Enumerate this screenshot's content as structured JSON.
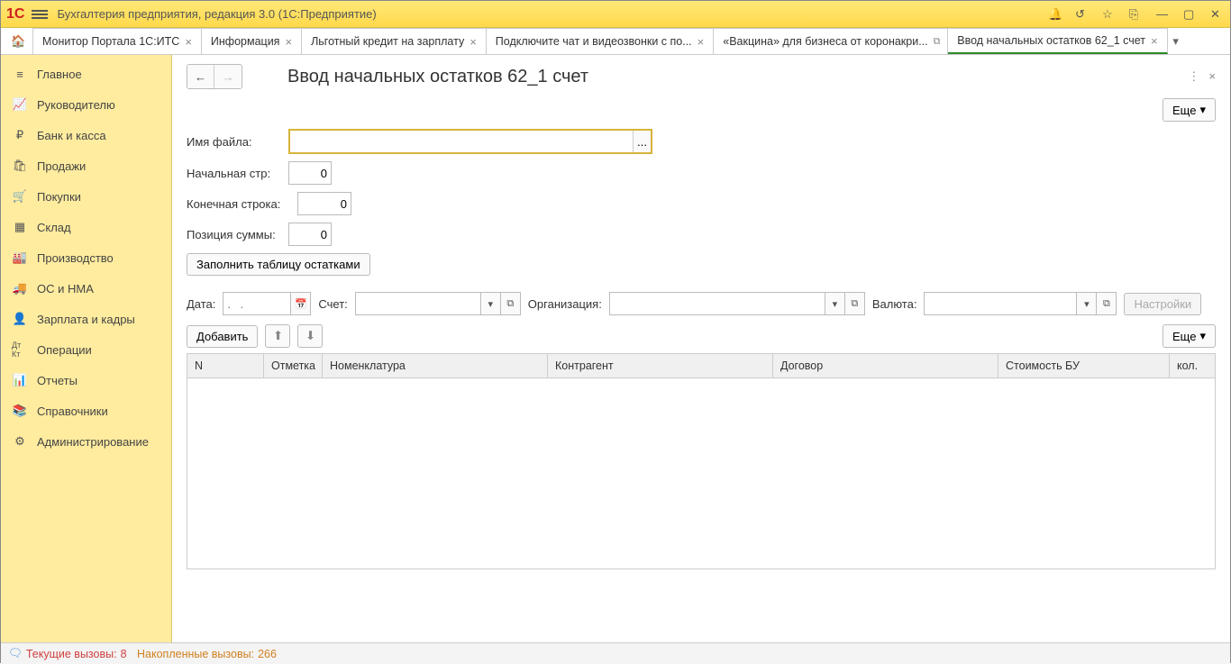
{
  "titlebar": {
    "app_title": "Бухгалтерия предприятия, редакция 3.0  (1С:Предприятие)"
  },
  "tabs": [
    {
      "label": "Монитор Портала 1С:ИТС"
    },
    {
      "label": "Информация"
    },
    {
      "label": "Льготный кредит на зарплату"
    },
    {
      "label": "Подключите чат и видеозвонки с по..."
    },
    {
      "label": "«Вакцина» для бизнеса от коронакри..."
    },
    {
      "label": "Ввод начальных остатков 62_1 счет",
      "active": true
    }
  ],
  "sidebar": [
    {
      "label": "Главное",
      "icon": "≡"
    },
    {
      "label": "Руководителю",
      "icon": "📈"
    },
    {
      "label": "Банк и касса",
      "icon": "₽"
    },
    {
      "label": "Продажи",
      "icon": "🛍"
    },
    {
      "label": "Покупки",
      "icon": "🛒"
    },
    {
      "label": "Склад",
      "icon": "▦"
    },
    {
      "label": "Производство",
      "icon": "🏭"
    },
    {
      "label": "ОС и НМА",
      "icon": "🚚"
    },
    {
      "label": "Зарплата и кадры",
      "icon": "👤"
    },
    {
      "label": "Операции",
      "icon": "Дт Кт"
    },
    {
      "label": "Отчеты",
      "icon": "📊"
    },
    {
      "label": "Справочники",
      "icon": "📚"
    },
    {
      "label": "Администрирование",
      "icon": "⚙"
    }
  ],
  "page": {
    "title": "Ввод начальных остатков 62_1 счет",
    "more": "Еще",
    "filename_label": "Имя файла:",
    "start_label": "Начальная стр:",
    "start_val": "0",
    "end_label": "Конечная строка:",
    "end_val": "0",
    "sum_label": "Позиция суммы:",
    "sum_val": "0",
    "fill_btn": "Заполнить таблицу остатками",
    "date_label": "Дата:",
    "date_placeholder": ".  .",
    "account_label": "Счет:",
    "org_label": "Организация:",
    "currency_label": "Валюта:",
    "settings_btn": "Настройки",
    "add_btn": "Добавить",
    "cols": {
      "n": "N",
      "mark": "Отметка",
      "nom": "Номенклатура",
      "contr": "Контрагент",
      "dog": "Договор",
      "cost": "Стоимость БУ",
      "qty": "кол."
    }
  },
  "status": {
    "cur_label": "Текущие вызовы:",
    "cur_val": "8",
    "acc_label": "Накопленные вызовы:",
    "acc_val": "266"
  }
}
